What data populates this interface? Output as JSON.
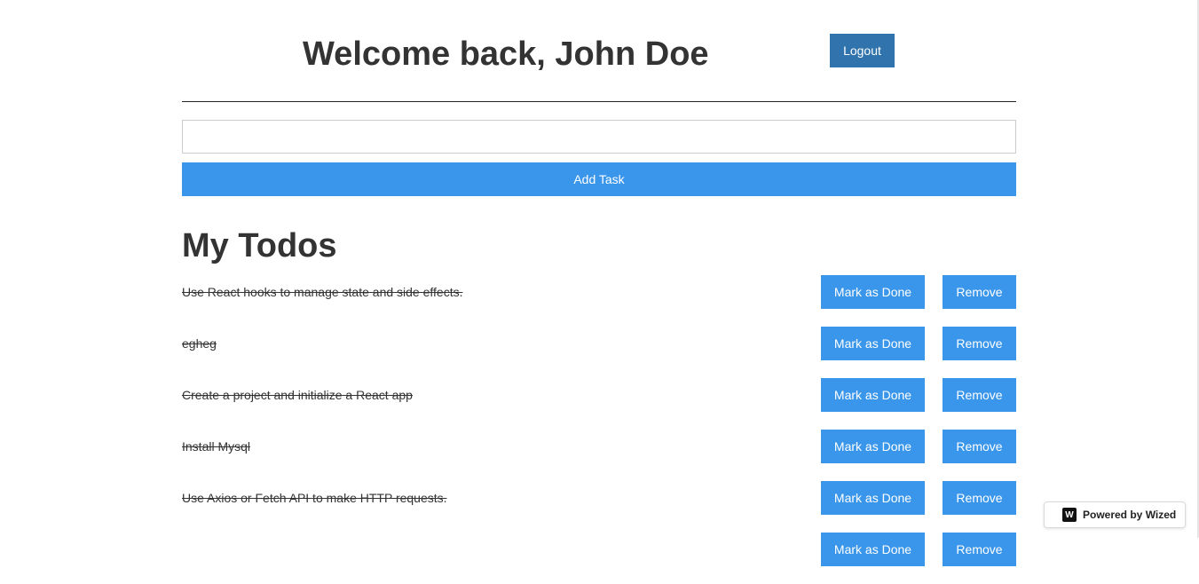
{
  "header": {
    "welcome": "Welcome back, John Doe",
    "logout_label": "Logout"
  },
  "form": {
    "task_input_value": "",
    "add_task_label": "Add Task"
  },
  "todos": {
    "title": "My Todos",
    "done_label": "Mark as Done",
    "remove_label": "Remove",
    "items": [
      {
        "text": "Use React hooks to manage state and side effects.",
        "completed": true
      },
      {
        "text": "egheg",
        "completed": true
      },
      {
        "text": "Create a project and initialize a React app",
        "completed": true
      },
      {
        "text": "Install Mysql",
        "completed": true
      },
      {
        "text": "Use Axios or Fetch API to make HTTP requests.",
        "completed": true
      }
    ]
  },
  "badge": {
    "icon": "wized-logo-icon",
    "logo_glyph": "W",
    "text": "Powered by Wized"
  },
  "colors": {
    "logout_button": "#3174ad",
    "primary_button": "#3a96ea",
    "heading_text": "#333333"
  }
}
